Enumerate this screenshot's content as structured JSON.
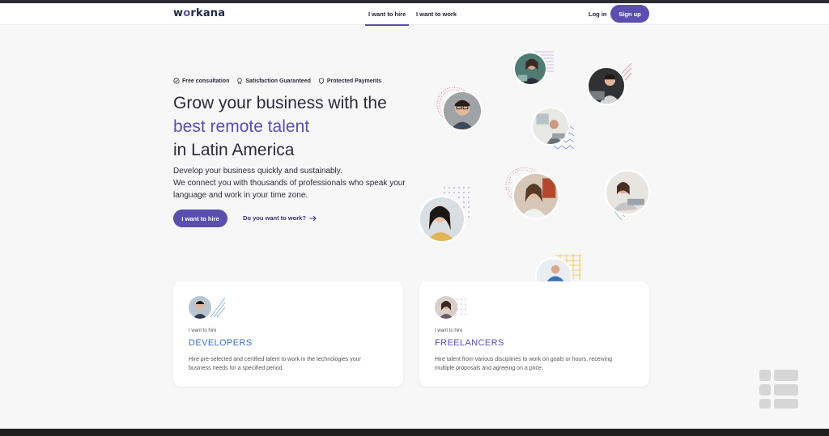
{
  "nav": {
    "logo": "workana",
    "tabs": [
      {
        "label": "I want to hire",
        "active": true
      },
      {
        "label": "I want to work",
        "active": false
      }
    ],
    "login": "Log in",
    "signup": "Sign up"
  },
  "hero": {
    "badges": [
      "Free consultation",
      "Satisfaction Guaranteed",
      "Protected Payments"
    ],
    "headline_1": "Grow your business with the",
    "headline_accent": "best remote talent",
    "headline_2": "in Latin America",
    "sub_1": "Develop your business quickly and sustainably.",
    "sub_2": "We connect you with thousands of professionals who speak your language and work in your time zone.",
    "cta_primary": "I want to hire",
    "cta_secondary": "Do you want to work?"
  },
  "cards": [
    {
      "kicker": "I want to hire",
      "title": "DEVELOPERS",
      "desc": "Hire pre-selected and certified talent to work in the technologies your business needs for a specified period."
    },
    {
      "kicker": "I want to hire",
      "title": "FREELANCERS",
      "desc": "Hire talent from various disciplines to work on goals or hours, receiving multiple proposals and agreeing on a price."
    }
  ],
  "colors": {
    "brand": "#5b4eae",
    "accent_blue": "#3b6fb6"
  }
}
